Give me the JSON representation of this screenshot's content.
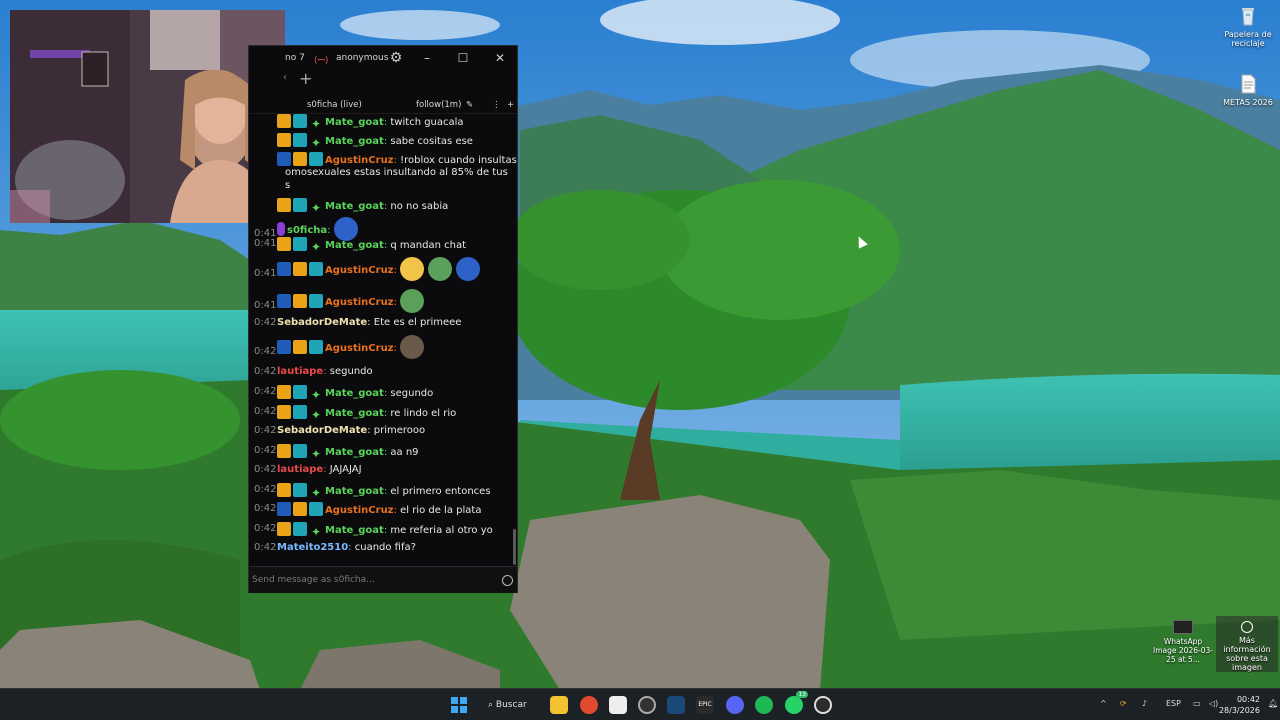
{
  "desktop": {
    "icons": [
      {
        "label": "Papelera de reciclaje",
        "icon": "recycle-bin-icon"
      },
      {
        "label": "METAS 2026",
        "icon": "text-file-icon"
      }
    ],
    "whatsapp_thumb": "WhatsApp Image 2026-03-25 at 5...",
    "image_info": "Más información sobre esta imagen"
  },
  "chat": {
    "titlebar": {
      "tab_partial": "no 7",
      "user": "anonymous"
    },
    "split": {
      "channel": "s0ficha (live)",
      "mode": "follow(1m)"
    },
    "input_placeholder": "Send message as s0ficha...",
    "messages": [
      {
        "time": "",
        "badges": [
          "crown",
          "sub",
          "vip"
        ],
        "user": "Mate_goat",
        "color": "#5ad35a",
        "text": "twitch guacala"
      },
      {
        "time": "",
        "badges": [
          "crown",
          "sub",
          "vip"
        ],
        "user": "Mate_goat",
        "color": "#5ad35a",
        "text": "sabe cositas ese"
      },
      {
        "time": "",
        "badges": [
          "mod",
          "crown",
          "sub"
        ],
        "user": "AgustinCruz",
        "color": "#e8701f",
        "text": "!roblox cuando insultas"
      },
      {
        "time": "",
        "badges": [],
        "user": "",
        "color": "#e8e8e8",
        "text": "omosexuales estas insultando al 85% de tus"
      },
      {
        "time": "",
        "badges": [],
        "user": "",
        "color": "#e8e8e8",
        "text": "s"
      },
      {
        "time": "",
        "badges": [
          "crown",
          "sub",
          "vip"
        ],
        "user": "Mate_goat",
        "color": "#5ad35a",
        "text": "no no sabia"
      },
      {
        "time": "0:41",
        "badges": [
          "mic"
        ],
        "user": "s0ficha",
        "color": "#5ad35a",
        "text": "",
        "emotes": 1
      },
      {
        "time": "0:41",
        "badges": [
          "crown",
          "sub",
          "vip"
        ],
        "user": "Mate_goat",
        "color": "#5ad35a",
        "text": "q mandan chat"
      },
      {
        "time": "0:41",
        "badges": [
          "mod",
          "crown",
          "sub"
        ],
        "user": "AgustinCruz",
        "color": "#e8701f",
        "text": "",
        "emotes": 3
      },
      {
        "time": "0:41",
        "badges": [
          "mod",
          "crown",
          "sub"
        ],
        "user": "AgustinCruz",
        "color": "#e8701f",
        "text": "",
        "emotes": 1
      },
      {
        "time": "0:42",
        "badges": [],
        "user": "SebadorDeMate",
        "color": "#f0e0b0",
        "text": "Ete es el primeee"
      },
      {
        "time": "0:42",
        "badges": [
          "mod",
          "crown",
          "sub"
        ],
        "user": "AgustinCruz",
        "color": "#e8701f",
        "text": "",
        "emotes": 1
      },
      {
        "time": "0:42",
        "badges": [],
        "user": "lautiape",
        "color": "#e84a4a",
        "text": "segundo"
      },
      {
        "time": "0:42",
        "badges": [
          "crown",
          "sub",
          "vip"
        ],
        "user": "Mate_goat",
        "color": "#5ad35a",
        "text": "segundo"
      },
      {
        "time": "0:42",
        "badges": [
          "crown",
          "sub",
          "vip"
        ],
        "user": "Mate_goat",
        "color": "#5ad35a",
        "text": "re lindo el rio"
      },
      {
        "time": "0:42",
        "badges": [],
        "user": "SebadorDeMate",
        "color": "#f0e0b0",
        "text": "primerooo"
      },
      {
        "time": "0:42",
        "badges": [
          "crown",
          "sub",
          "vip"
        ],
        "user": "Mate_goat",
        "color": "#5ad35a",
        "text": "aa n9"
      },
      {
        "time": "0:42",
        "badges": [],
        "user": "lautiape",
        "color": "#e84a4a",
        "text": "JAJAJAJ"
      },
      {
        "time": "0:42",
        "badges": [
          "crown",
          "sub",
          "vip"
        ],
        "user": "Mate_goat",
        "color": "#5ad35a",
        "text": "el primero entonces"
      },
      {
        "time": "0:42",
        "badges": [
          "mod",
          "crown",
          "sub"
        ],
        "user": "AgustinCruz",
        "color": "#e8701f",
        "text": "el rio de la plata"
      },
      {
        "time": "0:42",
        "badges": [
          "crown",
          "sub",
          "vip"
        ],
        "user": "Mate_goat",
        "color": "#5ad35a",
        "text": "me referia al otro yo"
      },
      {
        "time": "0:42",
        "badges": [],
        "user": "Mateito2510",
        "color": "#7ab8ff",
        "text": "cuando fifa?"
      }
    ]
  },
  "taskbar": {
    "search_label": "Buscar",
    "language": "ESP",
    "time": "00:42",
    "date": "28/3/2026",
    "whatsapp_badge": "13"
  }
}
